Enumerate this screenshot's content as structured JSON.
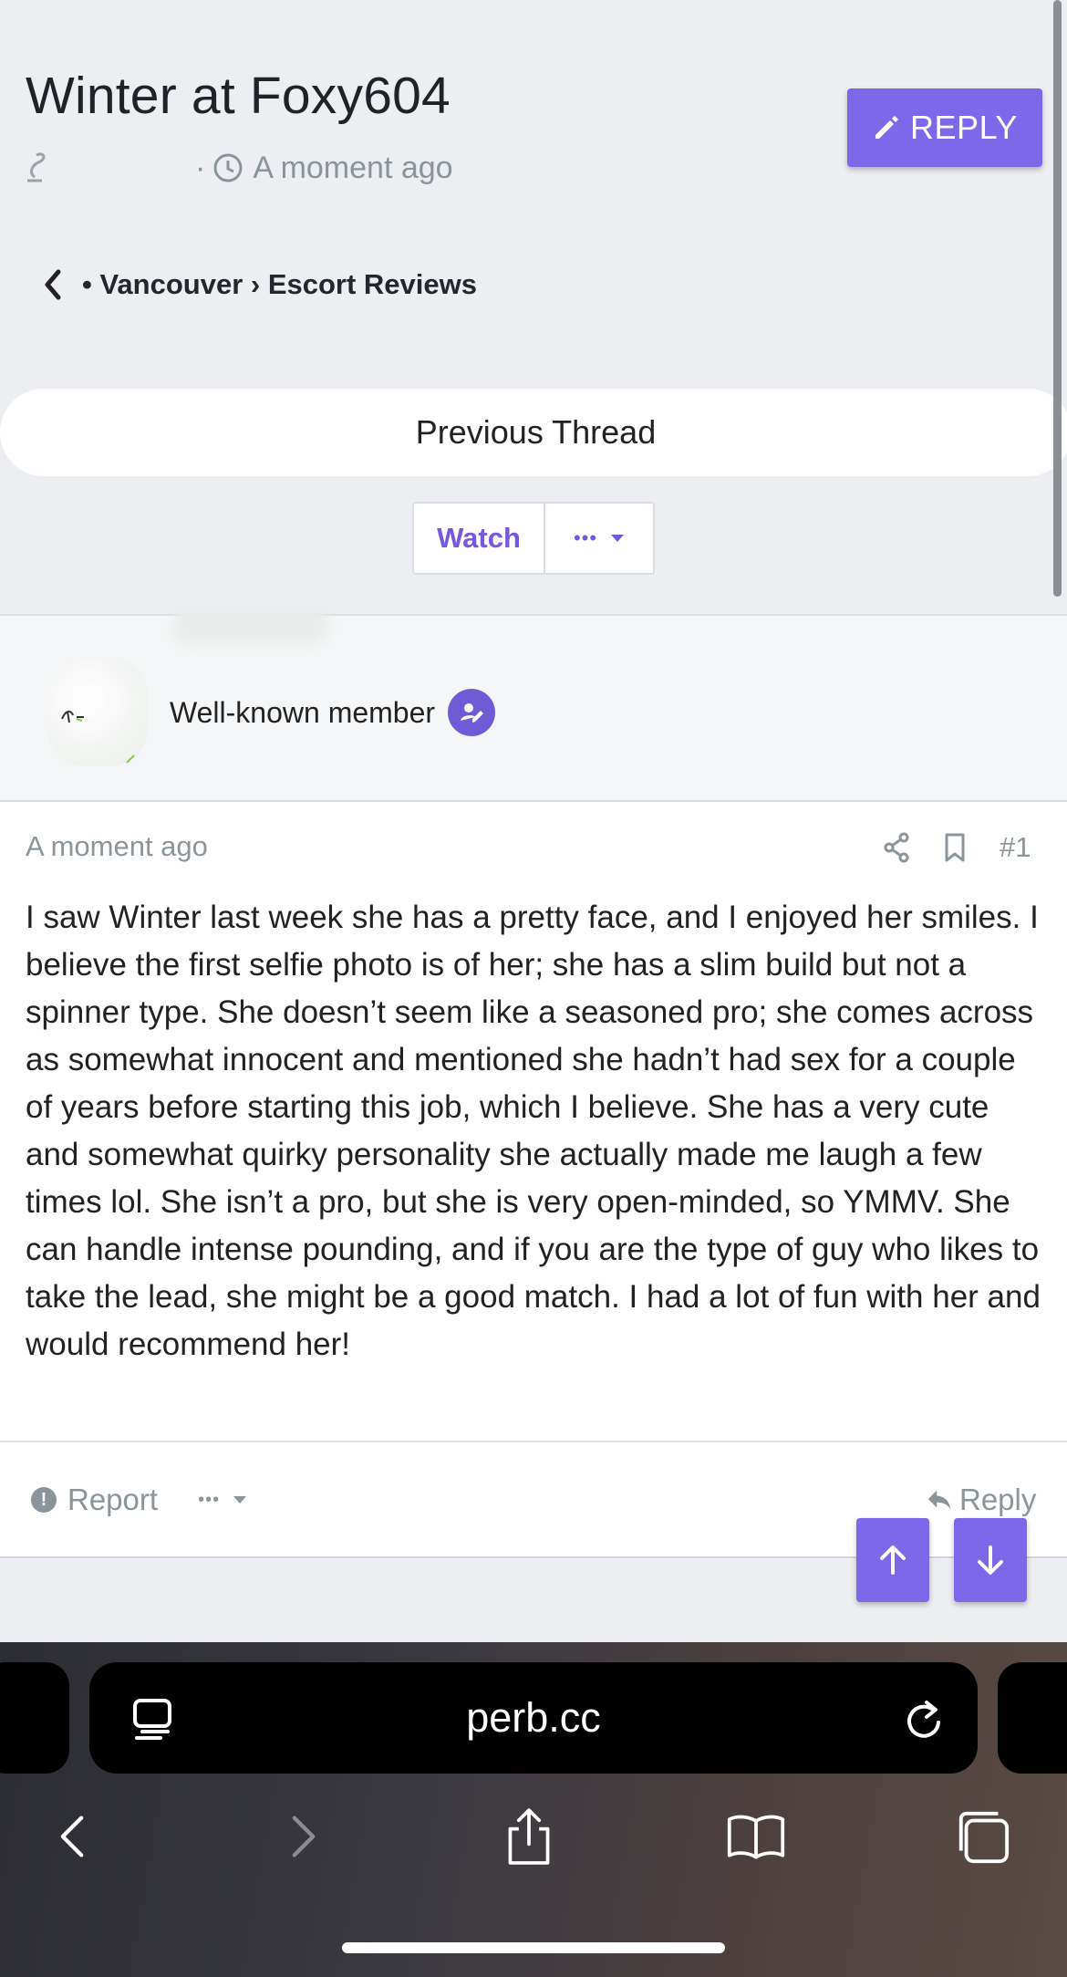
{
  "header": {
    "title": "Winter at Foxy604",
    "time": "A moment ago",
    "reply_label": "REPLY"
  },
  "breadcrumb": {
    "text": "• Vancouver › Escort Reviews"
  },
  "thread_nav": {
    "previous_label": "Previous Thread",
    "watch_label": "Watch",
    "more_label": "•••"
  },
  "post": {
    "user_title": "Well-known member",
    "time": "A moment ago",
    "number": "#1",
    "body": "I saw Winter last week she has a pretty face, and I enjoyed her smiles. I believe the first selfie photo is of her; she has a slim build but not a spinner type. She doesn’t seem like a seasoned pro; she comes across as somewhat innocent and mentioned she hadn’t had sex for a couple of years before starting this job, which I believe. She has a very cute and somewhat quirky personality she actually made me laugh a few times lol. She isn’t a pro, but she is very open-minded, so YMMV. She can handle intense pounding, and if you are the type of guy who likes to take the lead, she might be a good match. I had a lot of fun with her and would recommend her!",
    "report_label": "Report",
    "more_label": "•••",
    "reply_label": "Reply"
  },
  "browser": {
    "url": "perb.cc"
  },
  "colors": {
    "accent": "#7d68ea",
    "muted_text": "#8a9499",
    "page_bg": "#eceef2"
  },
  "icons": [
    "pencil-icon",
    "clock-icon",
    "chevron-left-icon",
    "share-icon",
    "bookmark-icon",
    "warning-icon",
    "reply-arrow-icon",
    "arrow-up-icon",
    "arrow-down-icon",
    "reader-icon",
    "reload-icon",
    "back-icon",
    "forward-icon",
    "share-sheet-icon",
    "bookmarks-icon",
    "tabs-icon"
  ]
}
